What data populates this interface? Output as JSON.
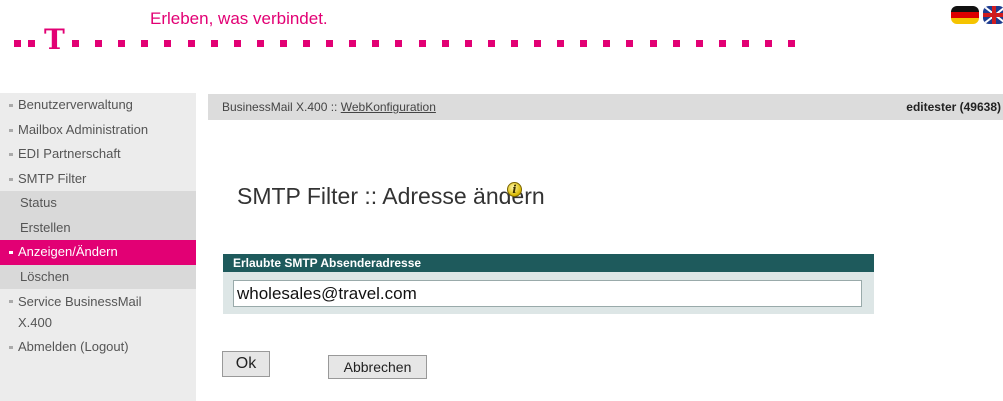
{
  "header": {
    "slogan": "Erleben, was verbindet.",
    "logo_letter": "T",
    "brand_color": "#e20074",
    "flags": [
      {
        "icon": "flag-germany-icon",
        "language": "de"
      },
      {
        "icon": "flag-uk-icon",
        "language": "en"
      }
    ]
  },
  "sidebar": {
    "items": [
      {
        "label": "Benutzerverwaltung",
        "type": "main"
      },
      {
        "label": "Mailbox Administration",
        "type": "main"
      },
      {
        "label": "EDI Partnerschaft",
        "type": "main"
      },
      {
        "label": "SMTP Filter",
        "type": "main"
      },
      {
        "label": "Status",
        "type": "sub"
      },
      {
        "label": "Erstellen",
        "type": "sub"
      },
      {
        "label": "Anzeigen/Ändern",
        "type": "active"
      },
      {
        "label": "Löschen",
        "type": "sub"
      },
      {
        "label": "Service BusinessMail X.400",
        "type": "main"
      },
      {
        "label": "Abmelden (Logout)",
        "type": "main"
      }
    ]
  },
  "topbar": {
    "breadcrumb_prefix": "BusinessMail X.400 :: ",
    "breadcrumb_link": "WebKonfiguration",
    "user": "editester (49638)"
  },
  "main": {
    "title": "SMTP Filter :: Adresse ändern",
    "info_icon": "info-icon",
    "field_label": "Erlaubte SMTP Absenderadresse",
    "field_value": "wholesales@travel.com",
    "ok_label": "Ok",
    "cancel_label": "Abbrechen"
  },
  "colors": {
    "accent": "#e20074",
    "panel_header": "#1e5a5c",
    "sidebar_bg": "#ececec"
  }
}
